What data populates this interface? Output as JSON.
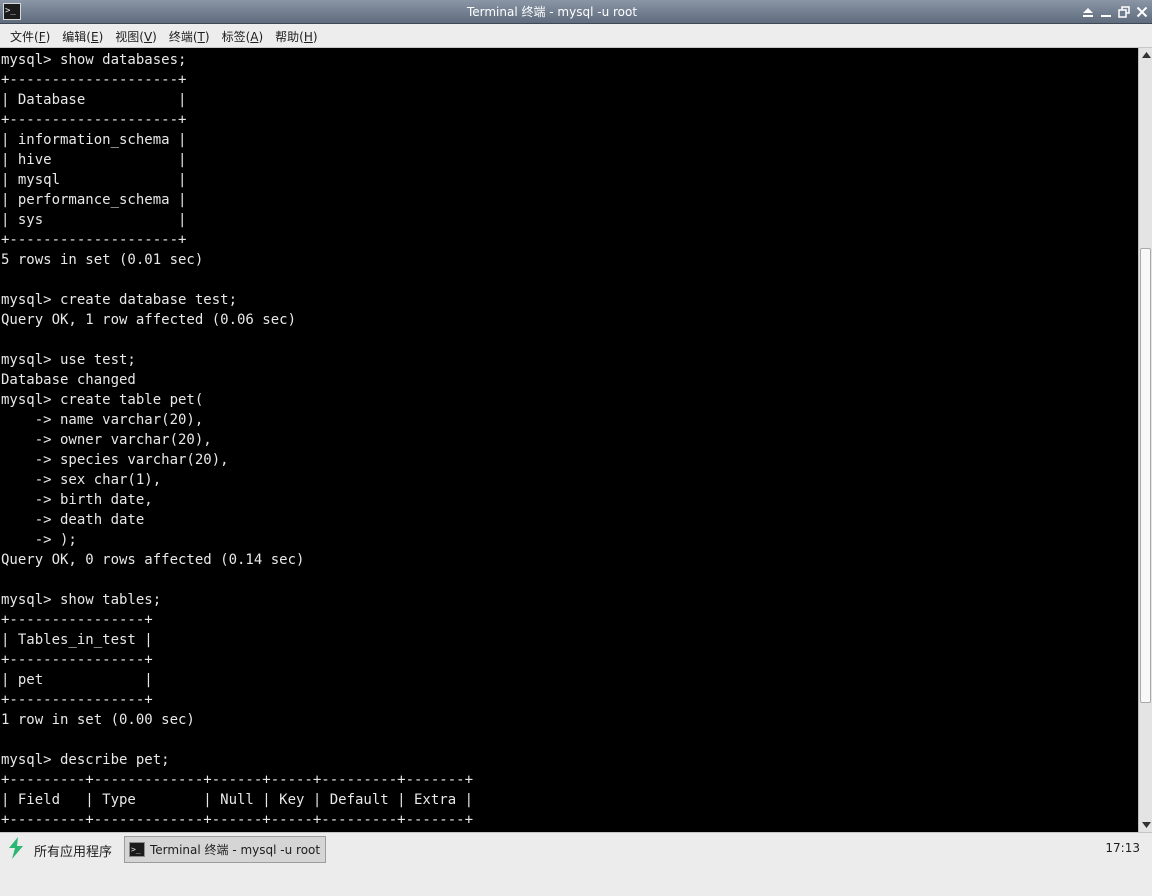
{
  "window": {
    "title": "Terminal 终端 - mysql -u root",
    "icon": "terminal-icon",
    "controls": [
      "shade-icon",
      "minimize-icon",
      "maximize-icon",
      "close-icon"
    ]
  },
  "menu": {
    "items": [
      {
        "label": "文件(",
        "mnemonic": "F",
        "suffix": ")"
      },
      {
        "label": "编辑(",
        "mnemonic": "E",
        "suffix": ")"
      },
      {
        "label": "视图(",
        "mnemonic": "V",
        "suffix": ")"
      },
      {
        "label": "终端(",
        "mnemonic": "T",
        "suffix": ")"
      },
      {
        "label": "标签(",
        "mnemonic": "A",
        "suffix": ")"
      },
      {
        "label": "帮助(",
        "mnemonic": "H",
        "suffix": ")"
      }
    ]
  },
  "terminal": {
    "lines": [
      "mysql> show databases;",
      "+--------------------+",
      "| Database           |",
      "+--------------------+",
      "| information_schema |",
      "| hive               |",
      "| mysql              |",
      "| performance_schema |",
      "| sys                |",
      "+--------------------+",
      "5 rows in set (0.01 sec)",
      "",
      "mysql> create database test;",
      "Query OK, 1 row affected (0.06 sec)",
      "",
      "mysql> use test;",
      "Database changed",
      "mysql> create table pet(",
      "    -> name varchar(20),",
      "    -> owner varchar(20),",
      "    -> species varchar(20),",
      "    -> sex char(1),",
      "    -> birth date,",
      "    -> death date",
      "    -> );",
      "Query OK, 0 rows affected (0.14 sec)",
      "",
      "mysql> show tables;",
      "+----------------+",
      "| Tables_in_test |",
      "+----------------+",
      "| pet            |",
      "+----------------+",
      "1 row in set (0.00 sec)",
      "",
      "mysql> describe pet;",
      "+---------+-------------+------+-----+---------+-------+",
      "| Field   | Type        | Null | Key | Default | Extra |",
      "+---------+-------------+------+-----+---------+-------+"
    ]
  },
  "taskbar": {
    "start_label": "所有应用程序",
    "start_icon": "app-menu-icon",
    "task_label": "Terminal 终端 - mysql -u root",
    "task_icon": "terminal-icon",
    "clock": "17:13"
  },
  "colors": {
    "terminal_bg": "#000000",
    "terminal_fg": "#e8e8e8",
    "titlebar": "#6f7c8d",
    "start_icon": "#2bb673"
  }
}
